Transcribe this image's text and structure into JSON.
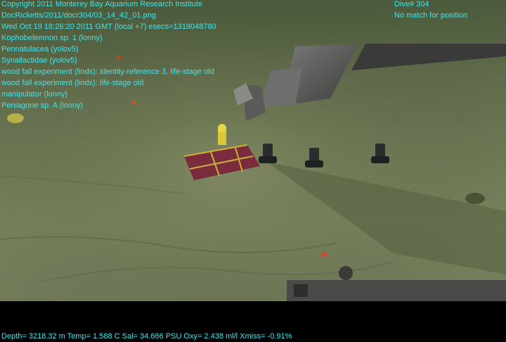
{
  "overlay": {
    "top_left_lines": [
      "Copyright 2011 Monterey Bay Aquarium Research Institute",
      "DocRicketts/2011/docr304/03_14_42_01.png",
      "Wed Oct 19 18:26:20 2011 GMT (local +7)  esecs=1319048780",
      "Kophobelemnon sp. 1 (lonny)",
      "Pennatulacea (yolov5)",
      "Synallactidae (yolov5)",
      "wood fall experiment (linds): identity-reference 3, life-stage old",
      "wood fall experiment (linds): life-stage old",
      "manipulator (lonny)",
      "Peniagone sp. A (lonny)"
    ],
    "top_right_lines": [
      "Dive# 304",
      "No match for position"
    ],
    "telemetry": "Depth= 3218.32 m  Temp= 1.588 C  Sal= 34.666 PSU  Oxy= 2.438 ml/l  Xmiss= -0.91%"
  },
  "colors": {
    "overlay_text": "#3ee6f0",
    "seafloor": "#6f7956",
    "background": "#000000"
  }
}
